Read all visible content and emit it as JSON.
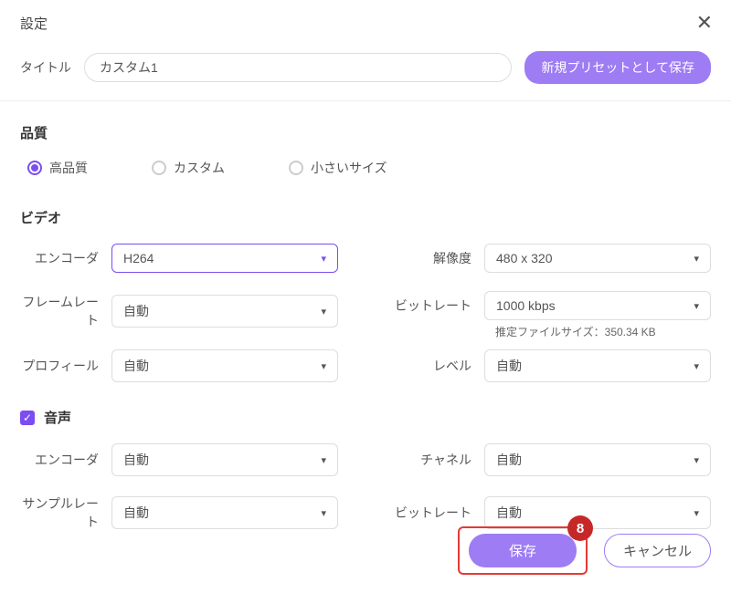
{
  "header": {
    "title": "設定"
  },
  "titleRow": {
    "label": "タイトル",
    "value": "カスタム1",
    "savePresetLabel": "新規プリセットとして保存"
  },
  "quality": {
    "sectionTitle": "品質",
    "options": [
      "高品質",
      "カスタム",
      "小さいサイズ"
    ],
    "selectedIndex": 0
  },
  "video": {
    "sectionTitle": "ビデオ",
    "encoder": {
      "label": "エンコーダ",
      "value": "H264"
    },
    "resolution": {
      "label": "解像度",
      "value": "480 x 320"
    },
    "framerate": {
      "label": "フレームレート",
      "value": "自動"
    },
    "bitrate": {
      "label": "ビットレート",
      "value": "1000 kbps"
    },
    "estimateNote": "推定ファイルサイズ：350.34 KB",
    "profile": {
      "label": "プロフィール",
      "value": "自動"
    },
    "level": {
      "label": "レベル",
      "value": "自動"
    }
  },
  "audio": {
    "sectionTitle": "音声",
    "checked": true,
    "encoder": {
      "label": "エンコーダ",
      "value": "自動"
    },
    "channel": {
      "label": "チャネル",
      "value": "自動"
    },
    "samplerate": {
      "label": "サンプルレート",
      "value": "自動"
    },
    "bitrate": {
      "label": "ビットレート",
      "value": "自動"
    }
  },
  "footer": {
    "save": "保存",
    "cancel": "キャンセル",
    "badge": "8"
  }
}
